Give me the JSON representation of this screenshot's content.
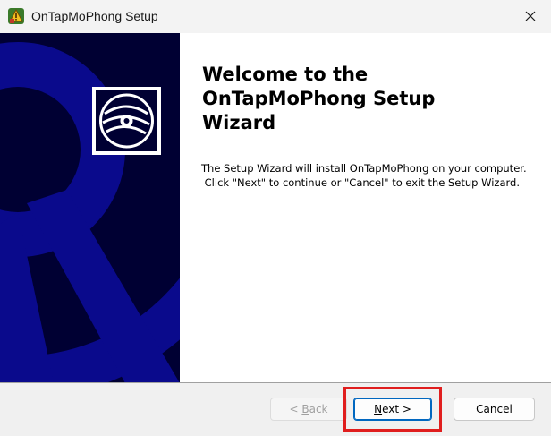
{
  "window": {
    "title": "OnTapMoPhong Setup"
  },
  "welcome": {
    "heading_line1": "Welcome to the",
    "heading_line2": "OnTapMoPhong Setup",
    "heading_line3": "Wizard",
    "desc_line1": "The Setup Wizard will install OnTapMoPhong on your computer.",
    "desc_line2": " Click \"Next\" to continue or \"Cancel\" to exit the Setup Wizard."
  },
  "buttons": {
    "back_pre": "< ",
    "back_key": "B",
    "back_post": "ack",
    "next_key": "N",
    "next_post": "ext >",
    "cancel": "Cancel"
  },
  "colors": {
    "banner_dark": "#000033",
    "banner_blue": "#0a0a8c",
    "highlight": "#e01e1e",
    "focus_border": "#0067c0"
  },
  "icons": {
    "app": "installer-warning-icon",
    "close": "close-icon",
    "banner": "cd-disc-icon"
  }
}
